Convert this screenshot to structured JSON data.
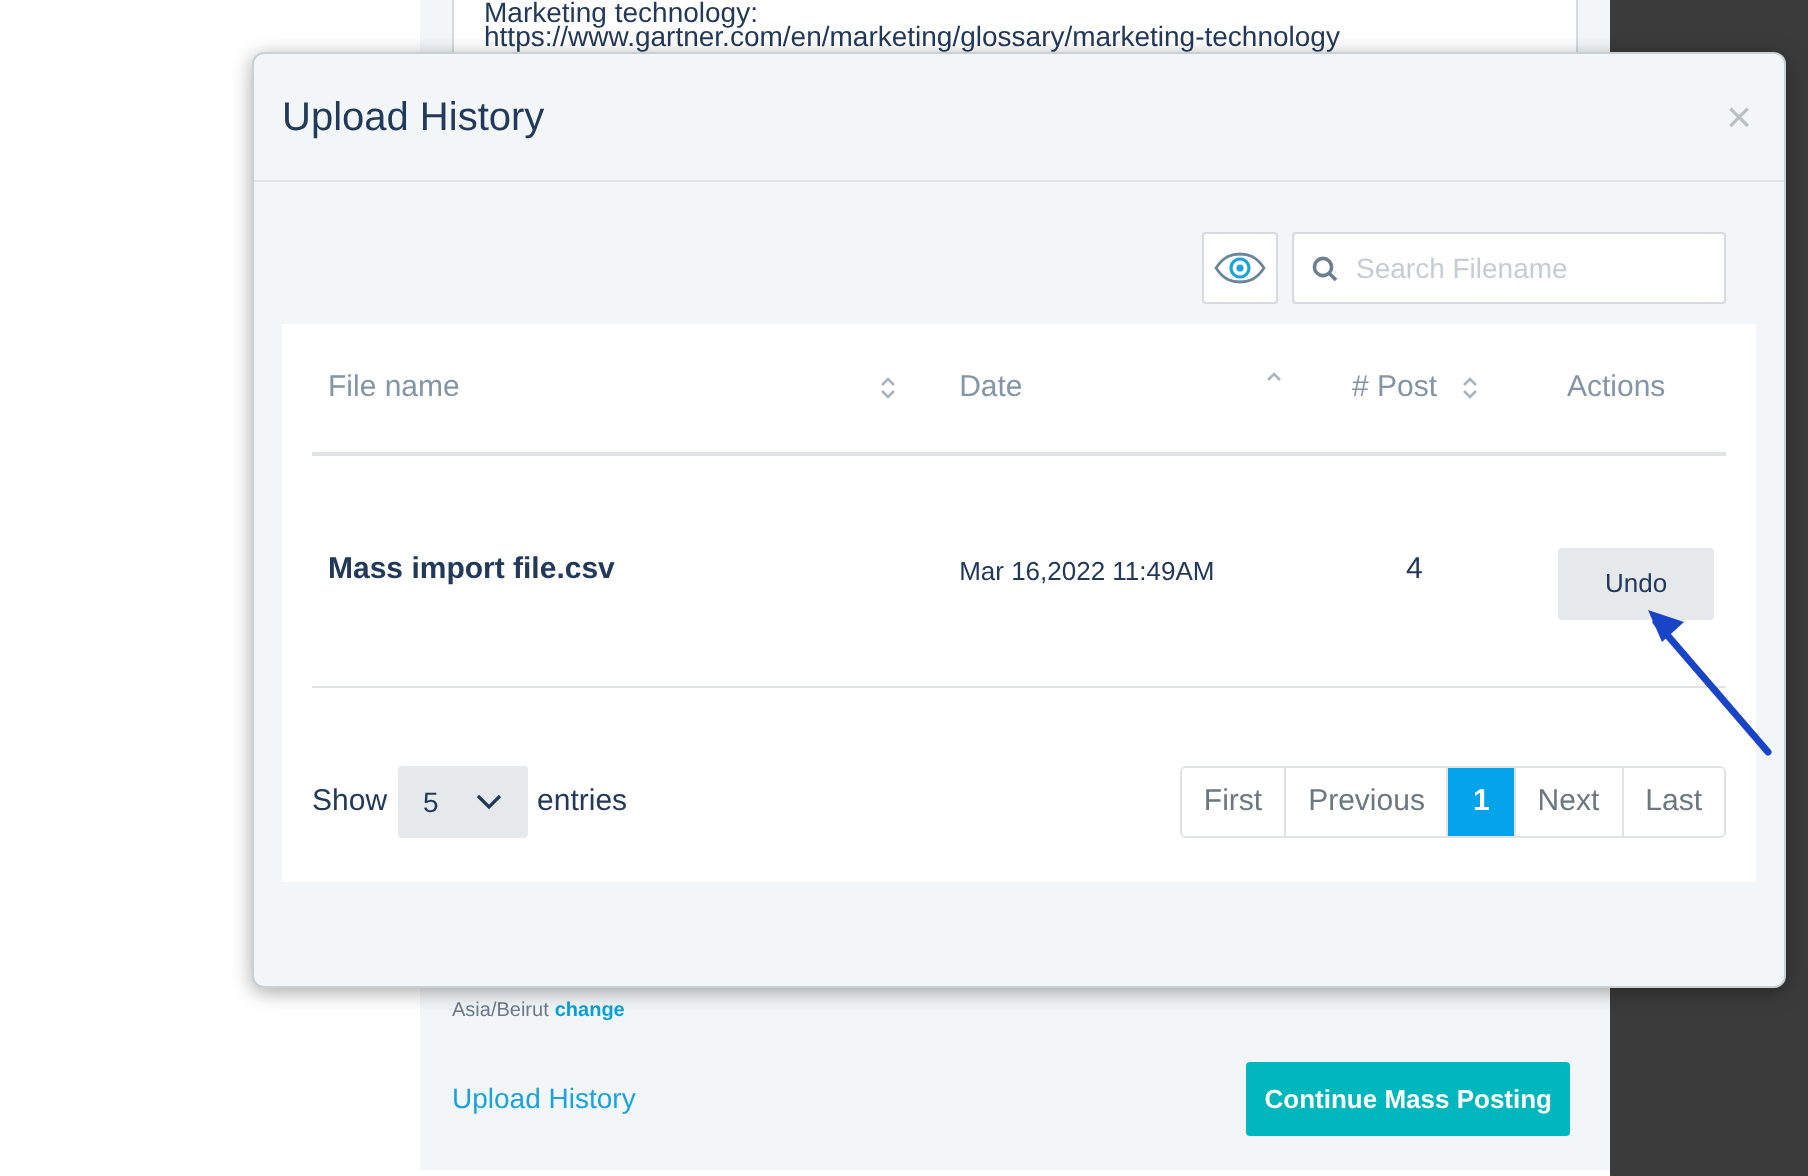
{
  "background": {
    "textarea_lines": [
      "Marketing technology:",
      "https://www.gartner.com/en/marketing/glossary/marketing-technology"
    ],
    "timezone": "Asia/Beirut",
    "timezone_link": "change",
    "history_link": "Upload History",
    "continue_button": "Continue Mass Posting"
  },
  "modal": {
    "title": "Upload History",
    "close": "×",
    "search": {
      "placeholder": "Search Filename"
    },
    "table": {
      "columns": [
        {
          "label": "File name",
          "sortable": true,
          "ascending": false
        },
        {
          "label": "Date",
          "sortable": true,
          "ascending": true
        },
        {
          "label": "# Post",
          "sortable": true,
          "ascending": false
        },
        {
          "label": "Actions",
          "sortable": false
        }
      ],
      "rows": [
        {
          "file_name": "Mass import file.csv",
          "date": "Mar 16,2022 11:49AM",
          "posts": "4",
          "action": "Undo"
        }
      ]
    },
    "footer": {
      "show": "Show",
      "page_size": "5",
      "entries": "entries",
      "pages": [
        {
          "label": "First",
          "selected": false
        },
        {
          "label": "Previous",
          "selected": false
        },
        {
          "label": "1",
          "selected": true
        },
        {
          "label": "Next",
          "selected": false
        },
        {
          "label": "Last",
          "selected": false
        }
      ]
    }
  }
}
